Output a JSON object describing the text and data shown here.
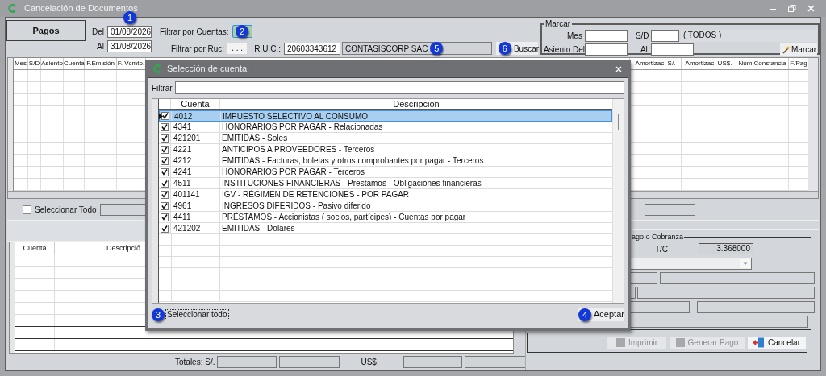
{
  "window": {
    "title": "Cancelación de Documentos"
  },
  "top": {
    "mode_button": "Pagos",
    "del_label": "Del",
    "del_value": "01/08/2026",
    "del_badge": "1",
    "al_label": "Al",
    "al_value": "31/08/2026",
    "filter_accounts_label": "Filtrar por Cuentas:",
    "filter_accounts_badge": "2",
    "filter_ruc_label": "Filtrar por Ruc:",
    "ruc_button": ". . .",
    "ruc_label": "R.U.C.:",
    "ruc_value": "20603343612",
    "company_value": "CONTASISCORP SAC",
    "company_badge": "5",
    "search_button": "Buscar",
    "search_badge": "6"
  },
  "marcar": {
    "title": "Marcar",
    "mes_label": "Mes",
    "sd_label": "S/D",
    "sd_text": "( TODOS )",
    "asiento_label": "Asiento Del",
    "al_label": "Al",
    "button": "Marcar"
  },
  "documents_table": {
    "columns_left": [
      "Mes",
      "S/D",
      "Asiento",
      "Cuenta",
      "F.Emisión",
      "F. Vcmto."
    ],
    "columns_right": [
      "Amortizac. S/.",
      "Amortizac. US$.",
      "Núm.Constancia",
      "F/Pag"
    ]
  },
  "select_all": {
    "label": "Seleccionar Todo",
    "checked": false
  },
  "detail_table": {
    "columns": [
      "Cuenta",
      "Descripció"
    ]
  },
  "totals": {
    "label_pen": "Totales: S/.",
    "label_usd": "US$."
  },
  "payment": {
    "group_title": "ago o Cobranza",
    "tc_label": "T/C",
    "tc_value": "3.368000",
    "dash_text": "-"
  },
  "buttons": [
    {
      "label": "Imprimir",
      "kind": "print",
      "disabled": true
    },
    {
      "label": "Generar Pago",
      "kind": "generate",
      "disabled": true
    },
    {
      "label": "Cancelar",
      "kind": "cancel",
      "disabled": false
    }
  ],
  "dialog": {
    "title": "Selección de cuenta:",
    "filter_label": "Filtrar",
    "columns": [
      "Cuenta",
      "Descripción"
    ],
    "rows": [
      {
        "cuenta": "4012",
        "descripcion": "IMPUESTO SELECTIVO AL CONSUMO",
        "checked": true,
        "selected": true
      },
      {
        "cuenta": "4341",
        "descripcion": "HONORARIOS POR PAGAR - Relacionadas",
        "checked": true,
        "selected": false
      },
      {
        "cuenta": "421201",
        "descripcion": "EMITIDAS - Soles",
        "checked": true,
        "selected": false
      },
      {
        "cuenta": "4221",
        "descripcion": "ANTICIPOS A PROVEEDORES - Terceros",
        "checked": true,
        "selected": false
      },
      {
        "cuenta": "4212",
        "descripcion": "EMITIDAS - Facturas, boletas y otros comprobantes por pagar - Terceros",
        "checked": true,
        "selected": false
      },
      {
        "cuenta": "4241",
        "descripcion": "HONORARIOS POR PAGAR - Terceros",
        "checked": true,
        "selected": false
      },
      {
        "cuenta": "4511",
        "descripcion": "INSTITUCIONES FINANCIERAS - Prestamos - Obligaciones financieras",
        "checked": true,
        "selected": false
      },
      {
        "cuenta": "401141",
        "descripcion": "IGV - RÉGIMEN DE RETENCIONES - POR PAGAR",
        "checked": true,
        "selected": false
      },
      {
        "cuenta": "4961",
        "descripcion": "INGRESOS DIFERIDOS - Pasivo diferido",
        "checked": true,
        "selected": false
      },
      {
        "cuenta": "4411",
        "descripcion": "PRÉSTAMOS - Accionistas ( socios, partícipes) - Cuentas por pagar",
        "checked": true,
        "selected": false
      },
      {
        "cuenta": "421202",
        "descripcion": "EMITIDAS - Dolares",
        "checked": true,
        "selected": false
      }
    ],
    "select_all_button": "Seleccionar todo",
    "select_all_badge": "3",
    "accept_button": "Aceptar",
    "accept_badge": "4"
  }
}
